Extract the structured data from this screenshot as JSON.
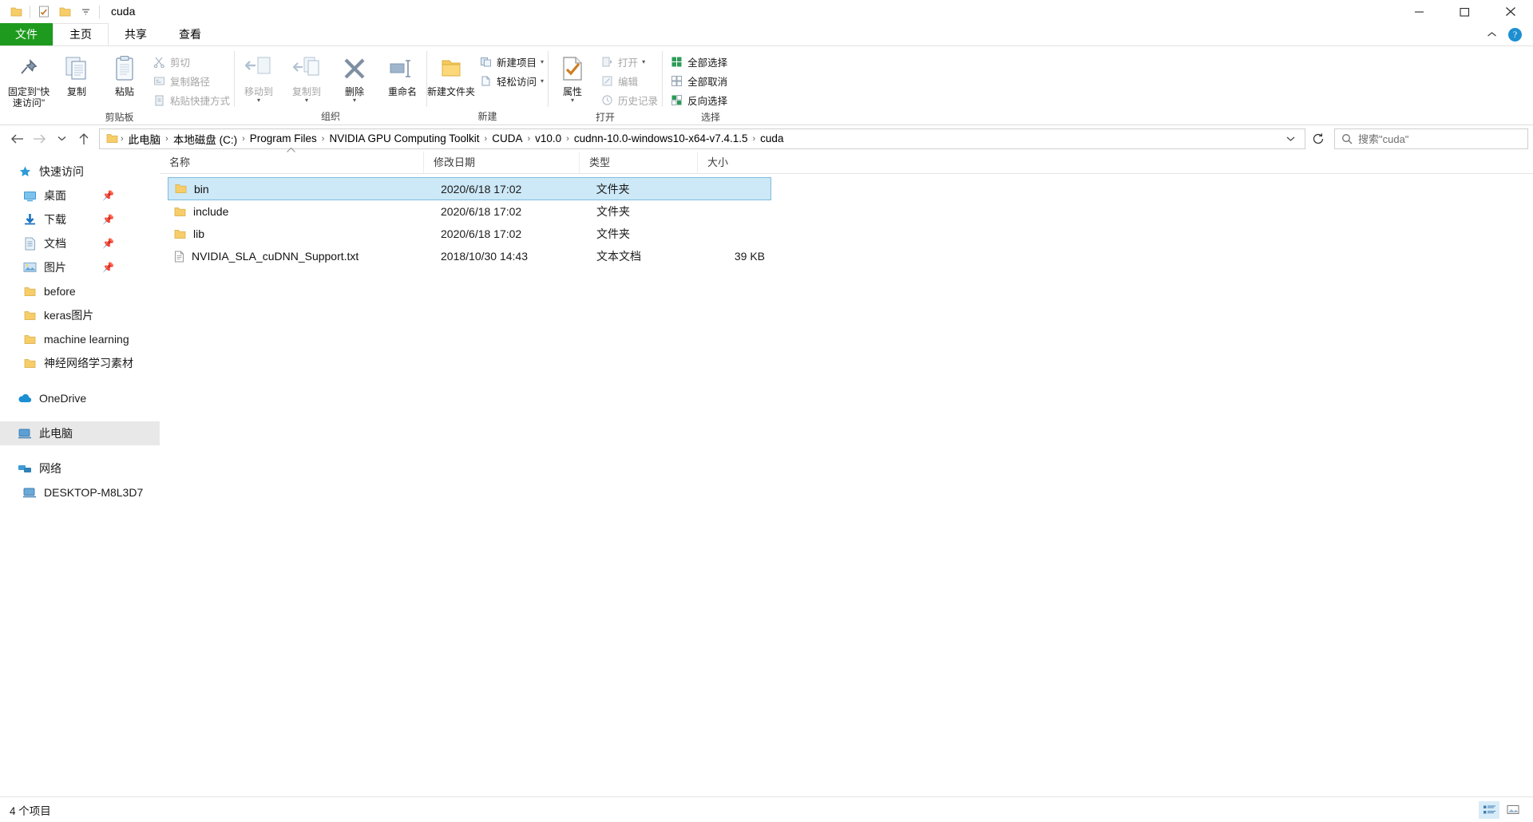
{
  "window": {
    "title": "cuda",
    "quick_access_icons": [
      "folder-icon",
      "properties-icon",
      "folder-icon"
    ],
    "qat_dropdown": "customize-qat-icon",
    "controls": {
      "minimize": "minimize-icon",
      "maximize": "maximize-icon",
      "close": "close-icon"
    }
  },
  "tabs": [
    {
      "label": "文件",
      "name": "tab-file"
    },
    {
      "label": "主页",
      "name": "tab-home"
    },
    {
      "label": "共享",
      "name": "tab-share"
    },
    {
      "label": "查看",
      "name": "tab-view"
    }
  ],
  "ribbon": {
    "collapse_icon": "chevron-up-icon",
    "help_icon": "help-icon",
    "groups": [
      {
        "label": "剪贴板",
        "name": "ribbon-group-clipboard",
        "big_buttons": [
          {
            "label": "固定到\"快速访问\"",
            "name": "pin-to-quick-access-button",
            "icon": "pin-icon",
            "disabled": false
          },
          {
            "label": "复制",
            "name": "copy-button",
            "icon": "copy-icon",
            "disabled": false
          },
          {
            "label": "粘贴",
            "name": "paste-button",
            "icon": "paste-icon",
            "disabled": false
          }
        ],
        "small_buttons": [
          {
            "label": "剪切",
            "name": "cut-button",
            "icon": "scissors-icon",
            "disabled": true
          },
          {
            "label": "复制路径",
            "name": "copy-path-button",
            "icon": "copy-path-icon",
            "disabled": true
          },
          {
            "label": "粘贴快捷方式",
            "name": "paste-shortcut-button",
            "icon": "paste-shortcut-icon",
            "disabled": true
          }
        ]
      },
      {
        "label": "组织",
        "name": "ribbon-group-organize",
        "big_buttons": [
          {
            "label": "移动到",
            "name": "move-to-button",
            "icon": "move-to-icon",
            "disabled": true,
            "caret": true
          },
          {
            "label": "复制到",
            "name": "copy-to-button",
            "icon": "copy-to-icon",
            "disabled": true,
            "caret": true
          },
          {
            "label": "删除",
            "name": "delete-button",
            "icon": "delete-x-icon",
            "disabled": false,
            "caret": true
          },
          {
            "label": "重命名",
            "name": "rename-button",
            "icon": "rename-icon",
            "disabled": false
          }
        ]
      },
      {
        "label": "新建",
        "name": "ribbon-group-new",
        "big_buttons": [
          {
            "label": "新建文件夹",
            "name": "new-folder-button",
            "icon": "new-folder-icon",
            "disabled": false
          }
        ],
        "small_buttons": [
          {
            "label": "新建项目",
            "name": "new-item-button",
            "icon": "new-item-icon",
            "disabled": false,
            "caret": true
          },
          {
            "label": "轻松访问",
            "name": "easy-access-button",
            "icon": "easy-access-icon",
            "disabled": false,
            "caret": true
          }
        ]
      },
      {
        "label": "打开",
        "name": "ribbon-group-open",
        "big_buttons": [
          {
            "label": "属性",
            "name": "properties-button",
            "icon": "properties-icon",
            "disabled": false,
            "caret": true
          }
        ],
        "small_buttons": [
          {
            "label": "打开",
            "name": "open-button",
            "icon": "open-icon",
            "disabled": true,
            "caret": true
          },
          {
            "label": "编辑",
            "name": "edit-button",
            "icon": "edit-icon",
            "disabled": true
          },
          {
            "label": "历史记录",
            "name": "history-button",
            "icon": "history-icon",
            "disabled": true
          }
        ]
      },
      {
        "label": "选择",
        "name": "ribbon-group-select",
        "small_buttons": [
          {
            "label": "全部选择",
            "name": "select-all-button",
            "icon": "select-all-icon",
            "disabled": false
          },
          {
            "label": "全部取消",
            "name": "select-none-button",
            "icon": "select-none-icon",
            "disabled": false
          },
          {
            "label": "反向选择",
            "name": "invert-selection-button",
            "icon": "invert-selection-icon",
            "disabled": false
          }
        ]
      }
    ]
  },
  "addressbar": {
    "back": "back-arrow-icon",
    "forward": "forward-arrow-icon",
    "recent": "recent-locations-icon",
    "up": "up-arrow-icon",
    "refresh": "refresh-icon",
    "folder_icon": "folder-icon",
    "breadcrumbs": [
      "此电脑",
      "本地磁盘 (C:)",
      "Program Files",
      "NVIDIA GPU Computing Toolkit",
      "CUDA",
      "v10.0",
      "cudnn-10.0-windows10-x64-v7.4.1.5",
      "cuda"
    ],
    "separator": "›",
    "dropdown_icon": "chevron-down-icon",
    "search": {
      "placeholder": "搜索\"cuda\"",
      "icon": "search-icon"
    }
  },
  "sidebar": {
    "sections": [
      {
        "name": "quick-access",
        "root": {
          "label": "快速访问",
          "icon": "star-pin-icon"
        },
        "items": [
          {
            "label": "桌面",
            "icon": "desktop-icon",
            "pinned": true
          },
          {
            "label": "下载",
            "icon": "downloads-icon",
            "pinned": true
          },
          {
            "label": "文档",
            "icon": "documents-icon",
            "pinned": true
          },
          {
            "label": "图片",
            "icon": "pictures-icon",
            "pinned": true
          },
          {
            "label": "before",
            "icon": "folder-icon",
            "pinned": false
          },
          {
            "label": "keras图片",
            "icon": "folder-icon",
            "pinned": false
          },
          {
            "label": "machine learning",
            "icon": "folder-icon",
            "pinned": false
          },
          {
            "label": "神经网络学习素材",
            "icon": "folder-icon",
            "pinned": false
          }
        ]
      },
      {
        "name": "onedrive",
        "root": {
          "label": "OneDrive",
          "icon": "onedrive-cloud-icon"
        },
        "items": []
      },
      {
        "name": "this-pc",
        "root": {
          "label": "此电脑",
          "icon": "this-pc-icon",
          "selected": true
        },
        "items": []
      },
      {
        "name": "network",
        "root": {
          "label": "网络",
          "icon": "network-icon"
        },
        "items": [
          {
            "label": "DESKTOP-M8L3D7",
            "icon": "computer-icon",
            "pinned": false
          }
        ]
      }
    ]
  },
  "filelist": {
    "columns": [
      {
        "label": "名称",
        "name": "column-name",
        "sorted": true,
        "sort_arrow": "▲"
      },
      {
        "label": "修改日期",
        "name": "column-date-modified",
        "sorted": false
      },
      {
        "label": "类型",
        "name": "column-type",
        "sorted": false
      },
      {
        "label": "大小",
        "name": "column-size",
        "sorted": false
      }
    ],
    "rows": [
      {
        "name": "bin",
        "date": "2020/6/18 17:02",
        "type": "文件夹",
        "size": "",
        "icon": "folder-icon",
        "selected": true
      },
      {
        "name": "include",
        "date": "2020/6/18 17:02",
        "type": "文件夹",
        "size": "",
        "icon": "folder-icon",
        "selected": false
      },
      {
        "name": "lib",
        "date": "2020/6/18 17:02",
        "type": "文件夹",
        "size": "",
        "icon": "folder-icon",
        "selected": false
      },
      {
        "name": "NVIDIA_SLA_cuDNN_Support.txt",
        "date": "2018/10/30 14:43",
        "type": "文本文档",
        "size": "39 KB",
        "icon": "text-file-icon",
        "selected": false
      }
    ]
  },
  "statusbar": {
    "item_count": "4 个项目",
    "views": [
      {
        "name": "details-view-button",
        "icon": "details-view-icon",
        "active": true
      },
      {
        "name": "large-icons-view-button",
        "icon": "large-icons-view-icon",
        "active": false
      }
    ]
  },
  "colors": {
    "file_tab_green": "#1e9b1e",
    "selection_blue": "#cde8f7",
    "selection_border": "#7fbde0",
    "folder_yellow": "#ffd264",
    "accent_blue": "#0078d7"
  }
}
